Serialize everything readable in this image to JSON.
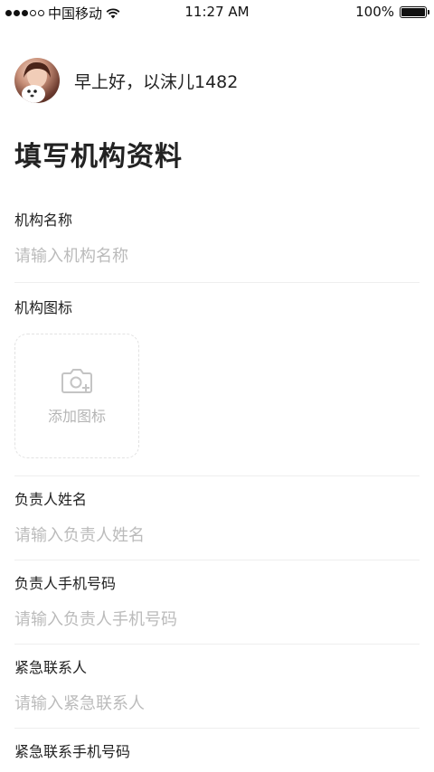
{
  "status_bar": {
    "carrier": "中国移动",
    "time": "11:27 AM",
    "battery": "100%"
  },
  "greeting": {
    "text": "早上好，以沫儿1482"
  },
  "page": {
    "title": "填写机构资料"
  },
  "form": {
    "org_name": {
      "label": "机构名称",
      "placeholder": "请输入机构名称",
      "value": ""
    },
    "org_icon": {
      "label": "机构图标",
      "upload_label": "添加图标"
    },
    "owner_name": {
      "label": "负责人姓名",
      "placeholder": "请输入负责人姓名",
      "value": ""
    },
    "owner_phone": {
      "label": "负责人手机号码",
      "placeholder": "请输入负责人手机号码",
      "value": ""
    },
    "emergency_contact": {
      "label": "紧急联系人",
      "placeholder": "请输入紧急联系人",
      "value": ""
    },
    "emergency_phone": {
      "label": "紧急联系手机号码"
    }
  },
  "icons": {
    "camera": "camera-icon",
    "wifi": "wifi-icon",
    "battery": "battery-icon"
  },
  "colors": {
    "text": "#222222",
    "placeholder": "#bbbbbb",
    "divider": "#eeeeee",
    "upload_border": "#e2e2e2"
  }
}
